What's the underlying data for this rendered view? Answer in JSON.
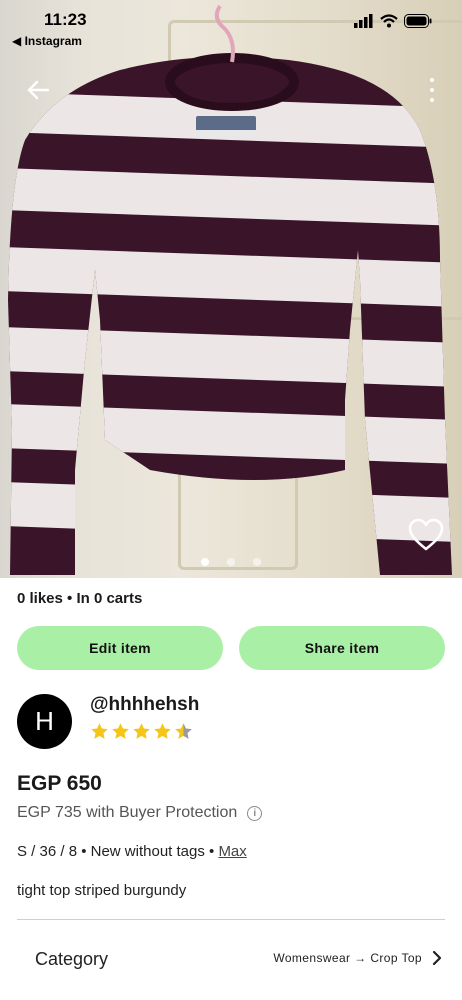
{
  "status_bar": {
    "time": "11:23",
    "back_app": "◀ Instagram"
  },
  "hero": {
    "photo_description": "",
    "page_count": 3,
    "active_page": 0
  },
  "listing": {
    "stats": "0 likes • In 0 carts",
    "edit_label": "Edit item",
    "share_label": "Share item"
  },
  "seller": {
    "avatar_initial": "H",
    "username": "@hhhhehsh",
    "rating": 4.5
  },
  "product": {
    "price": "EGP 650",
    "protection": "EGP 735 with Buyer Protection",
    "details": "S / 36 / 8 • New without tags • ",
    "brand": "Max",
    "description": "tight top striped burgundy"
  },
  "category": {
    "label": "Category",
    "value": "Womenswear → Crop Top"
  },
  "colors": {
    "button_green": "#a9f0a6",
    "stripe_dark": "#3a1428",
    "stripe_light": "#ece6e6",
    "star": "#f5c518"
  }
}
